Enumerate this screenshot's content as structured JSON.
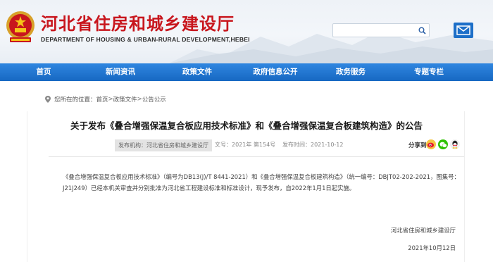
{
  "header": {
    "site_title": "河北省住房和城乡建设厅",
    "site_subtitle": "DEPARTMENT OF HOUSING & URBAN-RURAL DEVELOPMENT,HEBEI",
    "search_value": "",
    "brand_color": "#c8161d",
    "emblem_icon": "national-emblem-icon",
    "search_icon": "search-icon",
    "mail_icon": "mail-icon"
  },
  "nav": {
    "color": "#1d6fc8",
    "items": [
      "首页",
      "新闻资讯",
      "政策文件",
      "政府信息公开",
      "政务服务",
      "专题专栏"
    ]
  },
  "breadcrumb": {
    "label": "您所在的位置：",
    "items": [
      "首页",
      "政策文件",
      "公告公示"
    ],
    "separator": ">",
    "icon": "location-icon"
  },
  "article": {
    "title": "关于发布《叠合增强保温复合板应用技术标准》和《叠合增强保温复合板建筑构造》的公告",
    "issuer": "发布机构：河北省住房和城乡建设厅",
    "doc_number": "文号：2021年 第154号",
    "publish_time": "发布时间：2021-10-12",
    "share_label": "分享到",
    "share_icons": [
      "weibo-icon",
      "wechat-icon",
      "qq-icon"
    ],
    "body": "《叠合增强保温复合板应用技术标准》（编号为DB13(J)/T 8441-2021）和《叠合增强保温复合板建筑构造》（统一编号：DBJT02-202-2021，图集号：J21J249）已经本机关审查并分别批准为河北省工程建设标准和标准设计，现予发布，自2022年1月1日起实施。",
    "signature_org": "河北省住房和城乡建设厅",
    "signature_date": "2021年10月12日"
  }
}
